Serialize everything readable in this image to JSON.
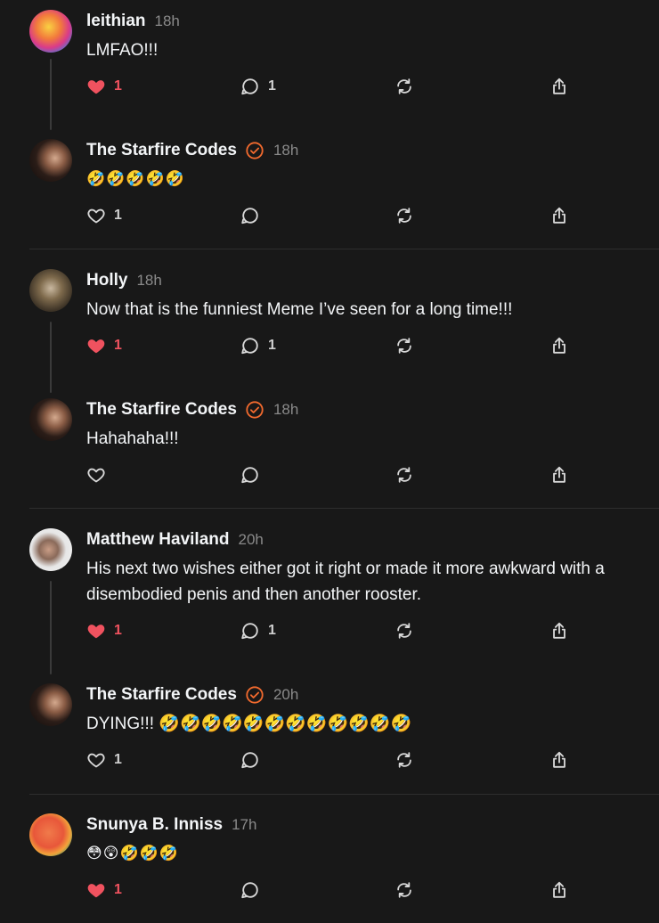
{
  "posts": [
    {
      "username": "leithian",
      "verified": false,
      "time": "18h",
      "lines": [
        "LMFAO!!!"
      ],
      "liked": true,
      "likes": "1",
      "replies": "1"
    },
    {
      "username": "The Starfire Codes",
      "verified": true,
      "time": "18h",
      "lines": [
        "🤣🤣🤣🤣🤣"
      ],
      "liked": false,
      "likes": "1",
      "replies": ""
    },
    {
      "username": "Holly",
      "verified": false,
      "time": "18h",
      "lines": [
        "Now that is the funniest Meme I’ve seen for a long time!!!"
      ],
      "liked": true,
      "likes": "1",
      "replies": "1"
    },
    {
      "username": "The Starfire Codes",
      "verified": true,
      "time": "18h",
      "lines": [
        "Hahahaha!!!"
      ],
      "liked": false,
      "likes": "",
      "replies": ""
    },
    {
      "username": "Matthew Haviland",
      "verified": false,
      "time": "20h",
      "lines": [
        "His next two wishes either got it right or made it more awkward with a",
        "disembodied penis and then another rooster."
      ],
      "liked": true,
      "likes": "1",
      "replies": "1"
    },
    {
      "username": "The Starfire Codes",
      "verified": true,
      "time": "20h",
      "lines": [
        "DYING!!! 🤣🤣🤣🤣🤣🤣🤣🤣🤣🤣🤣🤣"
      ],
      "liked": false,
      "likes": "1",
      "replies": ""
    },
    {
      "username": "Snunya B. Inniss",
      "verified": false,
      "time": "17h",
      "lines": [
        "😳😲🤣🤣🤣"
      ],
      "liked": true,
      "likes": "1",
      "replies": ""
    }
  ],
  "colors": {
    "liked": "#f0525f",
    "verified": "#f26a2e",
    "icon": "#d8d8d8",
    "muted": "#8a8a8a"
  },
  "icons": {
    "like": "heart-icon",
    "reply": "comment-icon",
    "repost": "repost-icon",
    "share": "share-icon",
    "verified": "verified-badge-icon"
  }
}
